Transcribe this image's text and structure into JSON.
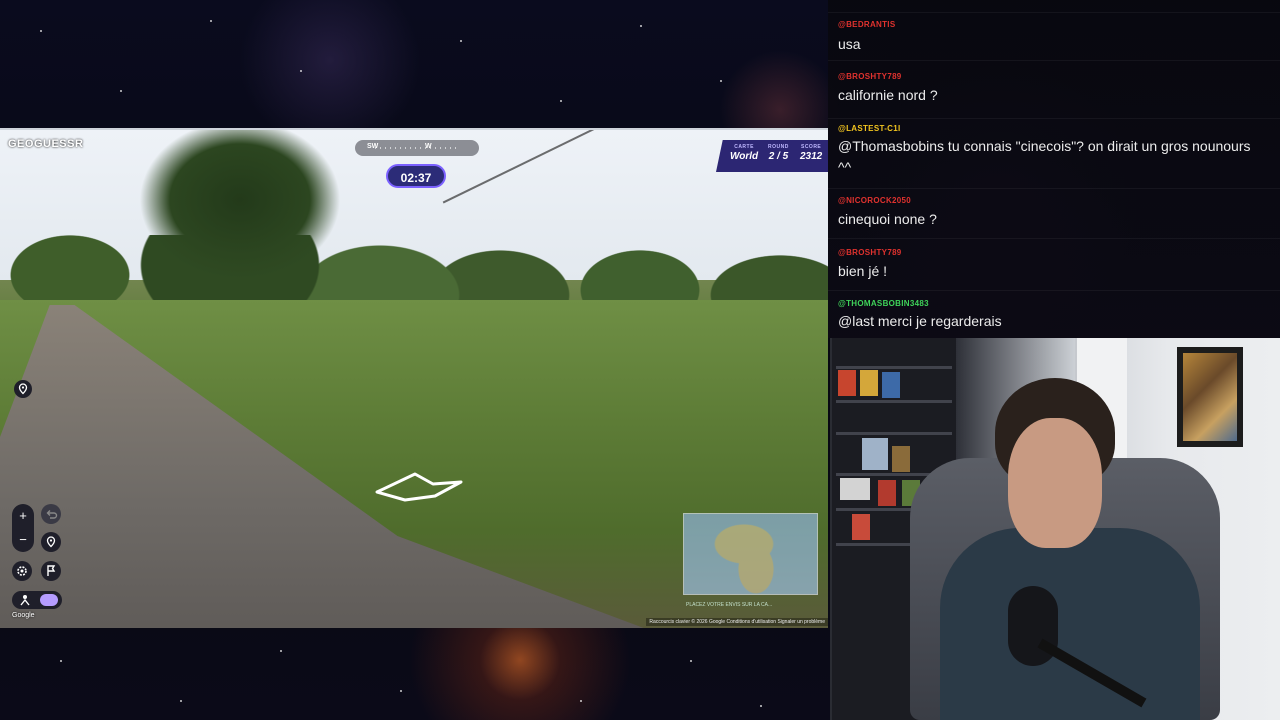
{
  "game": {
    "logo": "GEOGUESSR",
    "compass": {
      "left": "SW",
      "right": "W"
    },
    "timer": "02:37",
    "info": {
      "map_label": "CARTE",
      "map_value": "World",
      "round_label": "ROUND",
      "round_value": "2 / 5",
      "score_label": "SCORE",
      "score_value": "2312"
    },
    "controls": {
      "zoom_in": "+",
      "zoom_out": "−",
      "undo_icon": "undo-icon",
      "pin_icon": "pin-icon",
      "settings_icon": "gear-icon",
      "flag_icon": "flag-icon",
      "checkpoint_icon": "checkpoint-icon"
    },
    "google_attribution": "Google",
    "minimap_hint": "PLACEZ VOTRE ENVIS SUR LA CA...",
    "footer_links": "Raccourcis clavier   © 2026 Google   Conditions d'utilisation   Signaler un problème",
    "accent_color": "#7b61ff"
  },
  "chat": {
    "messages": [
      {
        "user": "@BEDRANTIS",
        "user_color": "#e0322e",
        "text": "usa"
      },
      {
        "user": "@BROSHTY789",
        "user_color": "#e0322e",
        "text": "californie nord ?"
      },
      {
        "user": "@LASTEST-C1I",
        "user_color": "#f2c41f",
        "text": "@Thomasbobins tu connais \"cinecois\"? on dirait un gros nounours ^^"
      },
      {
        "user": "@NICOROCK2050",
        "user_color": "#e0322e",
        "text": "cinequoi none ?"
      },
      {
        "user": "@BROSHTY789",
        "user_color": "#e0322e",
        "text": "bien jé !"
      },
      {
        "user": "@THOMASBOBIN3483",
        "user_color": "#3fd35a",
        "text": "@last merci je regarderais"
      }
    ]
  }
}
